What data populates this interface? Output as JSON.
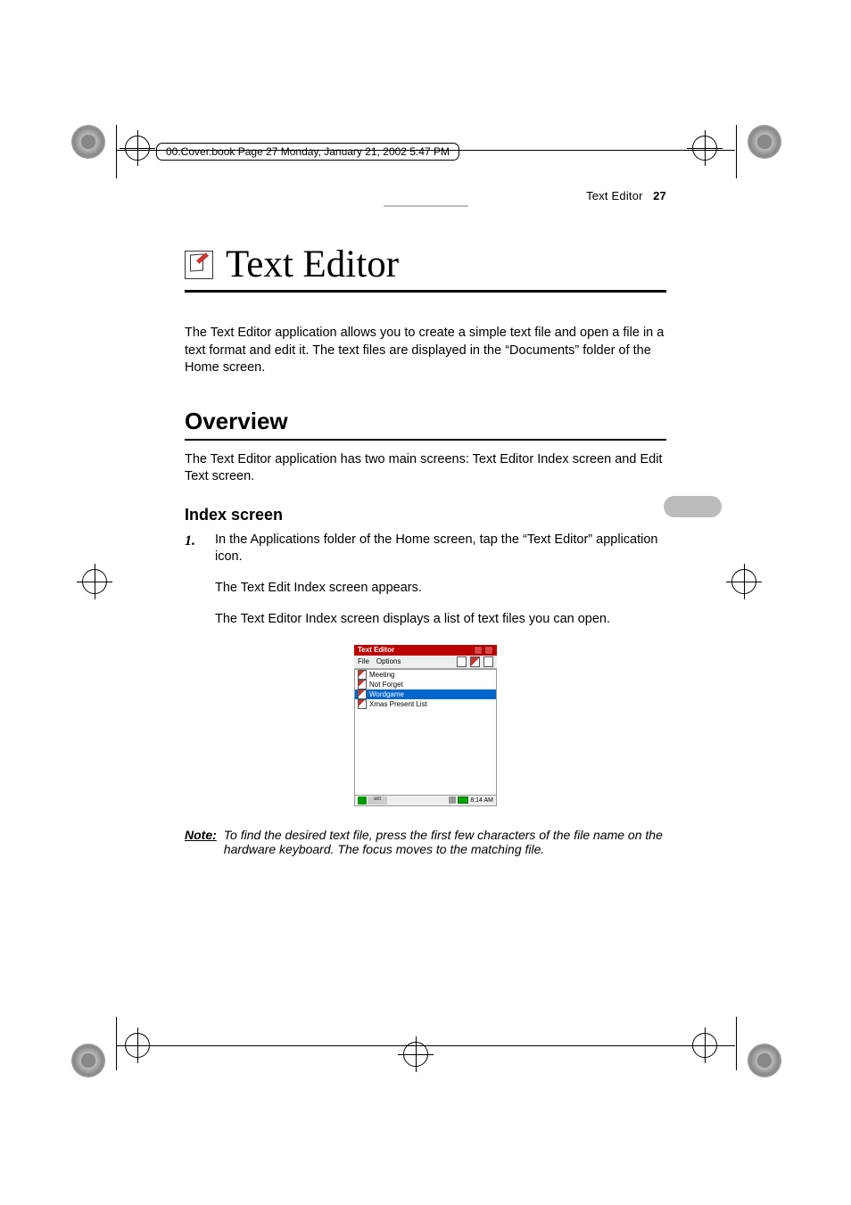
{
  "running_head": "00.Cover.book  Page 27  Monday, January 21, 2002  5:47 PM",
  "header": {
    "section": "Text Editor",
    "page": "27"
  },
  "title": "Text Editor",
  "intro": "The Text Editor application allows you to create a simple text file and open a file in a text format and edit it. The text files are displayed in the “Documents” folder of the Home screen.",
  "overview": {
    "heading": "Overview",
    "body": "The Text Editor application has two main screens: Text Editor Index screen and Edit Text screen."
  },
  "index_section": {
    "heading": "Index screen",
    "step_num": "1.",
    "step_text": "In the Applications folder of the Home screen, tap the “Text Editor” application icon.",
    "after1": "The Text Edit Index screen appears.",
    "after2": "The Text Editor Index screen displays a list of text files you can open."
  },
  "screenshot": {
    "title": "Text Editor",
    "menu_file": "File",
    "menu_options": "Options",
    "items": [
      "Meeting",
      "Not Forget",
      "Wordgame",
      "Xmas Present List"
    ],
    "selected_index": 2,
    "status_time": "8:14 AM",
    "status_label": "akt"
  },
  "note": {
    "label": "Note:",
    "text": "To find the desired text file, press the first few characters of the file name on the hardware keyboard. The focus moves to the matching file."
  }
}
